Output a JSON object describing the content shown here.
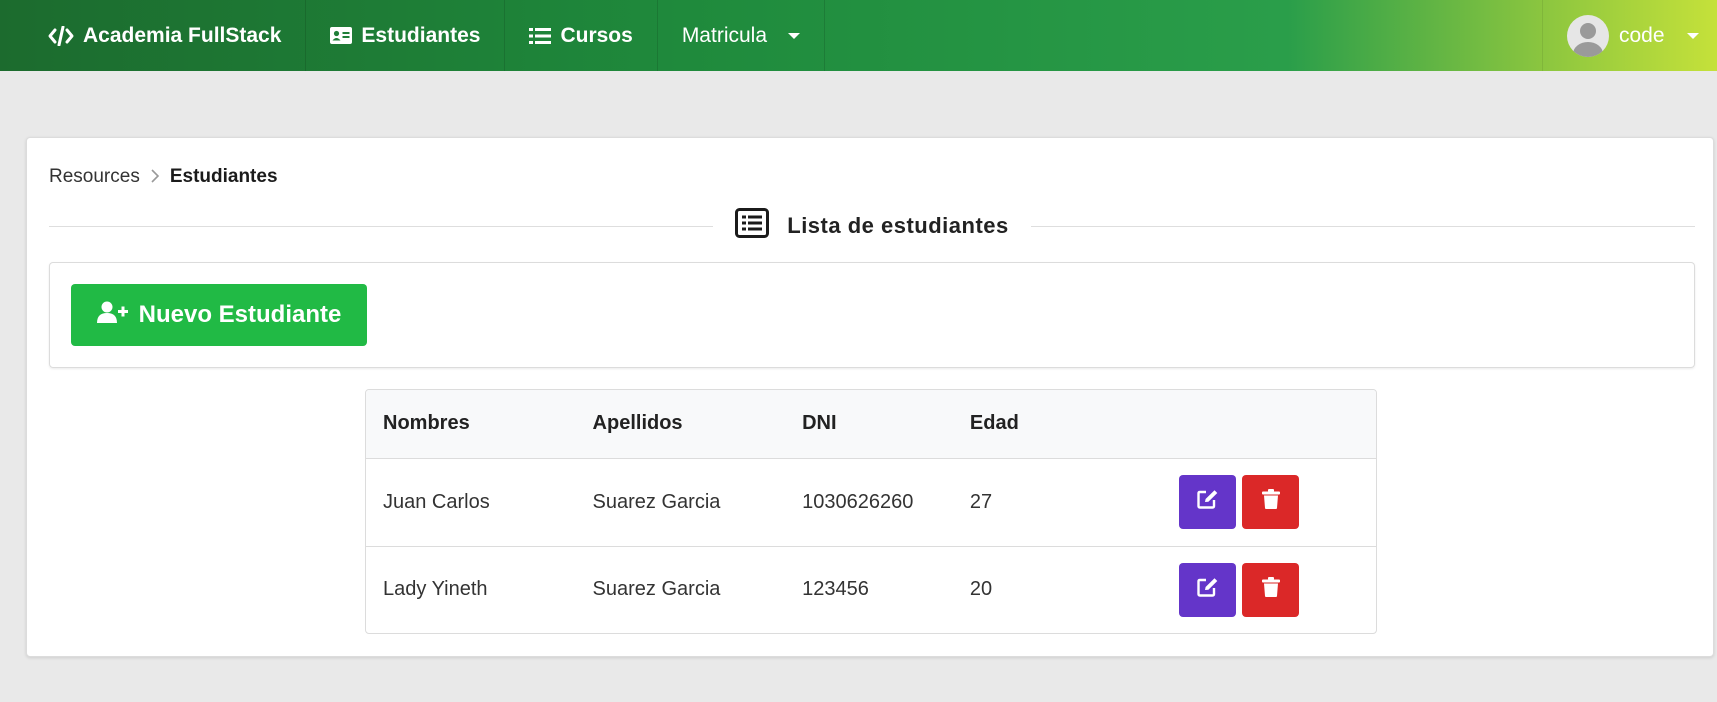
{
  "navbar": {
    "brand": "Academia FullStack",
    "items": [
      {
        "label": "Estudiantes",
        "icon": "id-card-icon"
      },
      {
        "label": "Cursos",
        "icon": "list-icon"
      },
      {
        "label": "Matricula",
        "icon": "caret-down-icon"
      }
    ],
    "user": "code"
  },
  "breadcrumb": {
    "parent": "Resources",
    "current": "Estudiantes"
  },
  "section_title": "Lista de estudiantes",
  "toolbar": {
    "new_label": "Nuevo Estudiante"
  },
  "table": {
    "headers": [
      "Nombres",
      "Apellidos",
      "DNI",
      "Edad"
    ],
    "rows": [
      {
        "nombres": "Juan Carlos",
        "apellidos": "Suarez Garcia",
        "dni": "1030626260",
        "edad": "27"
      },
      {
        "nombres": "Lady Yineth",
        "apellidos": "Suarez Garcia",
        "dni": "123456",
        "edad": "20"
      }
    ]
  },
  "colors": {
    "primary_green": "#21ba45",
    "edit_purple": "#6435c9",
    "delete_red": "#db2828"
  }
}
